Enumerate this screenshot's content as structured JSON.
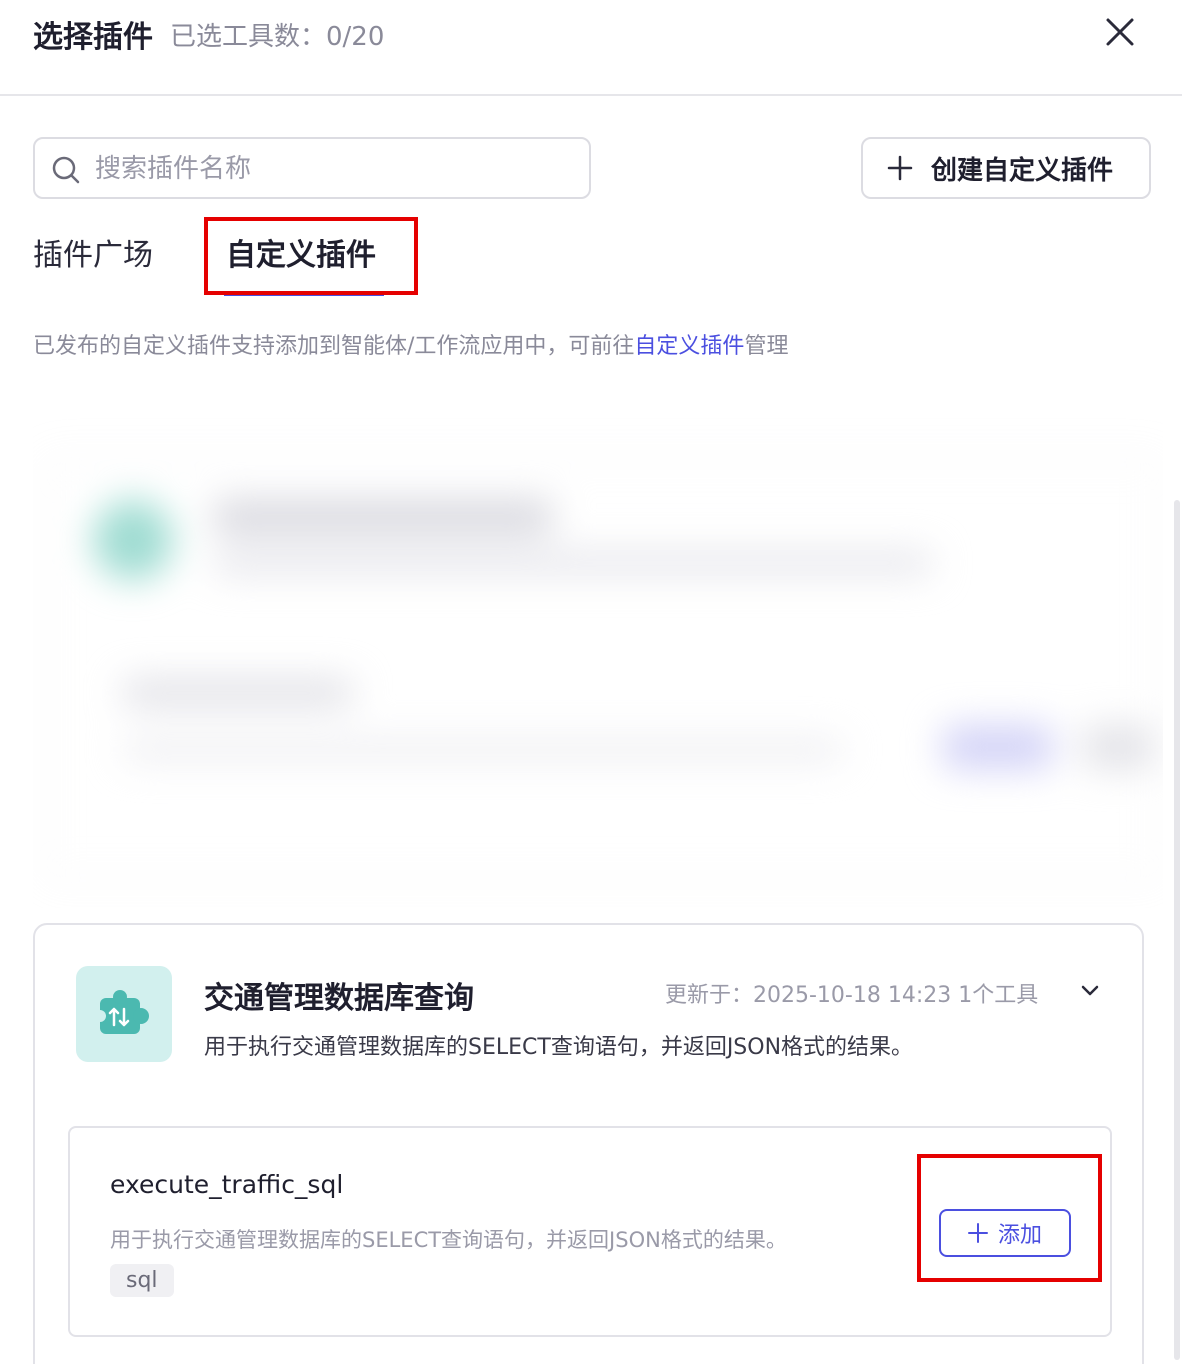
{
  "header": {
    "title": "选择插件",
    "selected_count": "已选工具数：0/20"
  },
  "search": {
    "placeholder": "搜索插件名称",
    "value": ""
  },
  "toolbar": {
    "create_label": "创建自定义插件"
  },
  "tabs": [
    {
      "label": "插件广场",
      "active": false
    },
    {
      "label": "自定义插件",
      "active": true
    }
  ],
  "info": {
    "prefix": "已发布的自定义插件支持添加到智能体/工作流应用中，可前往",
    "link": "自定义插件",
    "suffix": "管理"
  },
  "plugin": {
    "name": "交通管理数据库查询",
    "meta": "更新于：2025-10-18 14:23   1个工具",
    "description": "用于执行交通管理数据库的SELECT查询语句，并返回JSON格式的结果。",
    "tool": {
      "name": "execute_traffic_sql",
      "description": "用于执行交通管理数据库的SELECT查询语句，并返回JSON格式的结果。",
      "tag": "sql",
      "add_label": "添加"
    }
  },
  "colors": {
    "accent": "#4b4fe0",
    "highlight": "#e50000",
    "icon_bg": "#d2f0ee",
    "icon_fg": "#4bb9b0"
  }
}
